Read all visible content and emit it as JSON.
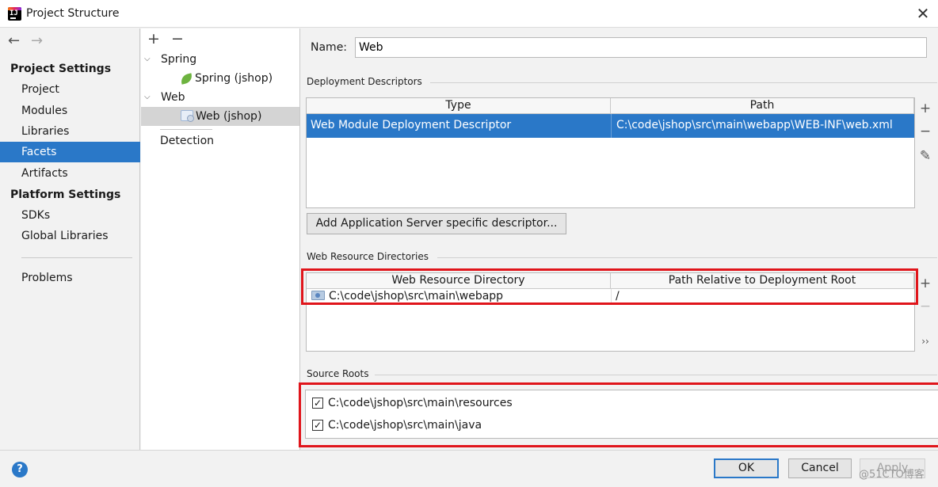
{
  "window": {
    "title": "Project Structure",
    "close_glyph": "✕"
  },
  "nav": {
    "back_glyph": "←",
    "forward_glyph": "→"
  },
  "sidebar": {
    "project_settings_header": "Project Settings",
    "project_settings_items": [
      "Project",
      "Modules",
      "Libraries",
      "Facets",
      "Artifacts"
    ],
    "selected_item": "Facets",
    "platform_settings_header": "Platform Settings",
    "platform_settings_items": [
      "SDKs",
      "Global Libraries"
    ],
    "problems_label": "Problems"
  },
  "tree": {
    "add_glyph": "+",
    "remove_glyph": "−",
    "nodes": [
      {
        "label": "Spring",
        "expanded": true
      },
      {
        "label": "Spring (jshop)",
        "icon": "spring-leaf-icon"
      },
      {
        "label": "Web",
        "expanded": true
      },
      {
        "label": "Web (jshop)",
        "icon": "web-facet-icon",
        "selected": true
      }
    ],
    "detection_label": "Detection"
  },
  "facet": {
    "name_label": "Name:",
    "name_value": "Web",
    "deployment_descriptors": {
      "title": "Deployment Descriptors",
      "columns": [
        "Type",
        "Path"
      ],
      "rows": [
        {
          "type": "Web Module Deployment Descriptor",
          "path": "C:\\code\\jshop\\src\\main\\webapp\\WEB-INF\\web.xml",
          "selected": true
        }
      ],
      "add_glyph": "+",
      "remove_glyph": "−",
      "edit_glyph": "✎",
      "add_server_button": "Add Application Server specific descriptor..."
    },
    "web_resource_directories": {
      "title": "Web Resource Directories",
      "columns": [
        "Web Resource Directory",
        "Path Relative to Deployment Root"
      ],
      "rows": [
        {
          "directory": "C:\\code\\jshop\\src\\main\\webapp",
          "relative_path": "/"
        }
      ],
      "add_glyph": "+",
      "remove_glyph": "−",
      "more_glyph": "››"
    },
    "source_roots": {
      "title": "Source Roots",
      "items": [
        {
          "path": "C:\\code\\jshop\\src\\main\\resources",
          "checked": true
        },
        {
          "path": "C:\\code\\jshop\\src\\main\\java",
          "checked": true
        }
      ]
    }
  },
  "footer": {
    "help_glyph": "?",
    "ok_label": "OK",
    "cancel_label": "Cancel",
    "apply_label": "Apply"
  },
  "watermark": "@51CTO博客",
  "colors": {
    "selection": "#2a78c8",
    "highlight_box": "#e0151b"
  }
}
